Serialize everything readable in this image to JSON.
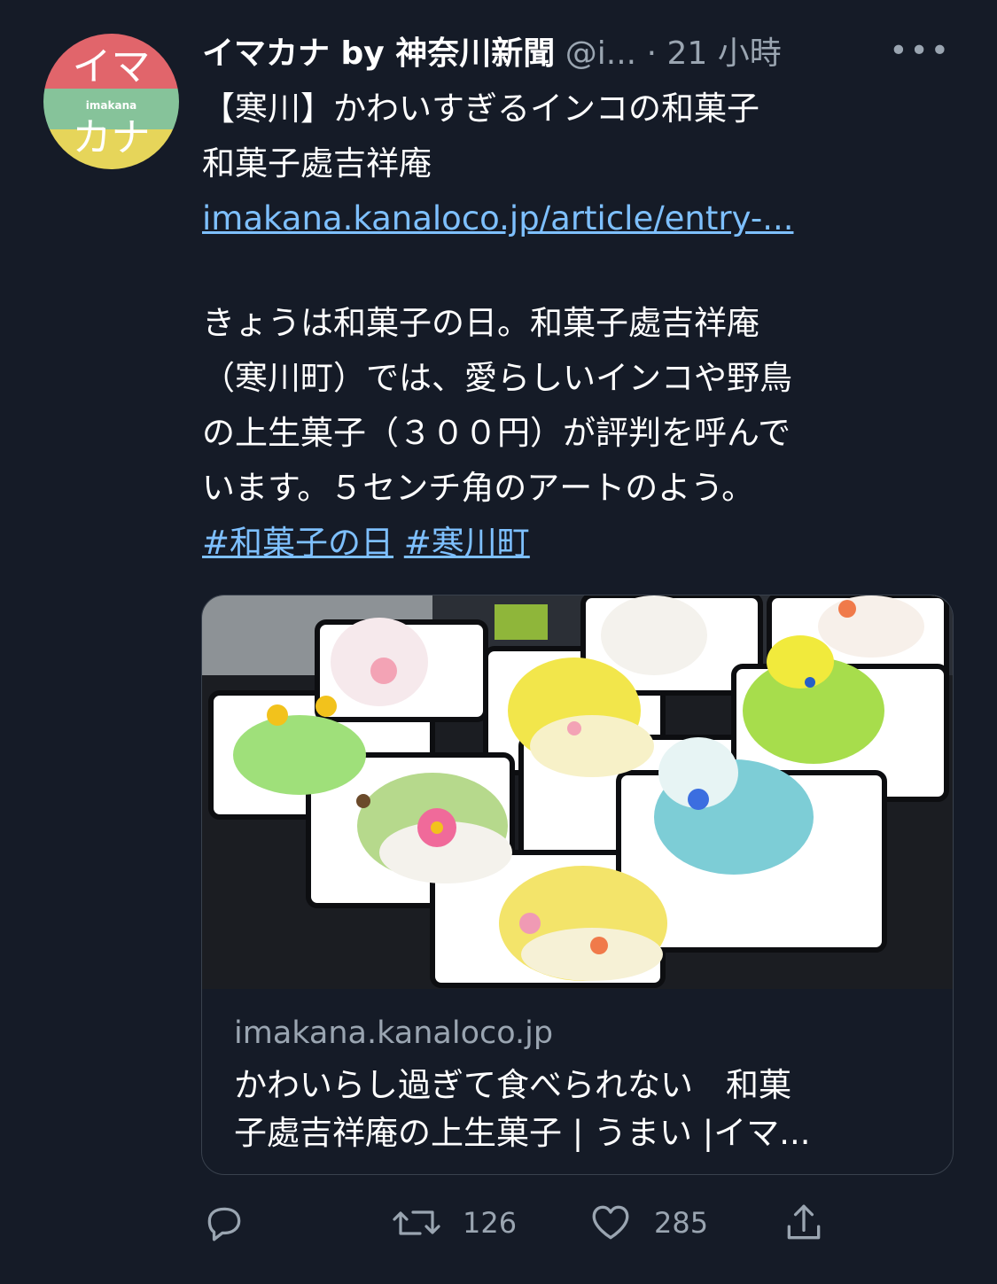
{
  "avatar": {
    "text_top": "イマ",
    "text_mid": "imakana",
    "text_bottom": "カナ"
  },
  "tweet": {
    "author": "イマカナ by 神奈川新聞",
    "handle": "@i...",
    "separator": "·",
    "time": "21 小時",
    "more": "•••",
    "lines": [
      "【寒川】かわいすぎるインコの和菓子",
      "和菓子處吉祥庵"
    ],
    "link": "imakana.kanaloco.jp/article/entry-...",
    "body_lines": [
      "きょうは和菓子の日。和菓子處吉祥庵",
      "（寒川町）では、愛らしいインコや野鳥",
      "の上生菓子（３００円）が評判を呼んで",
      "います。５センチ角のアートのよう。"
    ],
    "hashtags": [
      "#和菓子の日",
      "#寒川町"
    ]
  },
  "card": {
    "domain": "imakana.kanaloco.jp",
    "title_line1": "かわいらし過ぎて食べられない　和菓",
    "title_line2": "子處吉祥庵の上生菓子 | うまい |イマ..."
  },
  "actions": {
    "reply_icon": "reply-icon",
    "retweet_icon": "retweet-icon",
    "retweet_count": "126",
    "like_icon": "heart-icon",
    "like_count": "285",
    "share_icon": "share-icon"
  }
}
